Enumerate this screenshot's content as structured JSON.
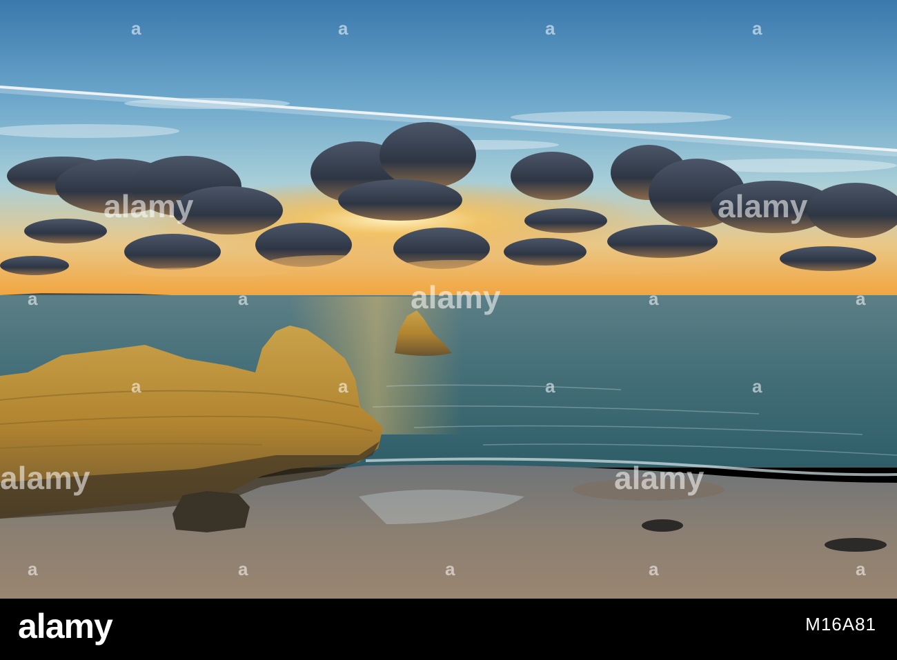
{
  "footer": {
    "logo_text": "alamy",
    "image_id": "M16A81"
  },
  "watermark": {
    "text": "alamy",
    "mark": "a"
  },
  "colors": {
    "sky_top": "#3f7fb3",
    "sky_mid": "#8fc4dc",
    "horizon_glow": "#f4b24a",
    "sea": "#3d6e78",
    "rock": "#b98f3a",
    "sand": "#8a7f72",
    "footer_bg": "#000000"
  }
}
